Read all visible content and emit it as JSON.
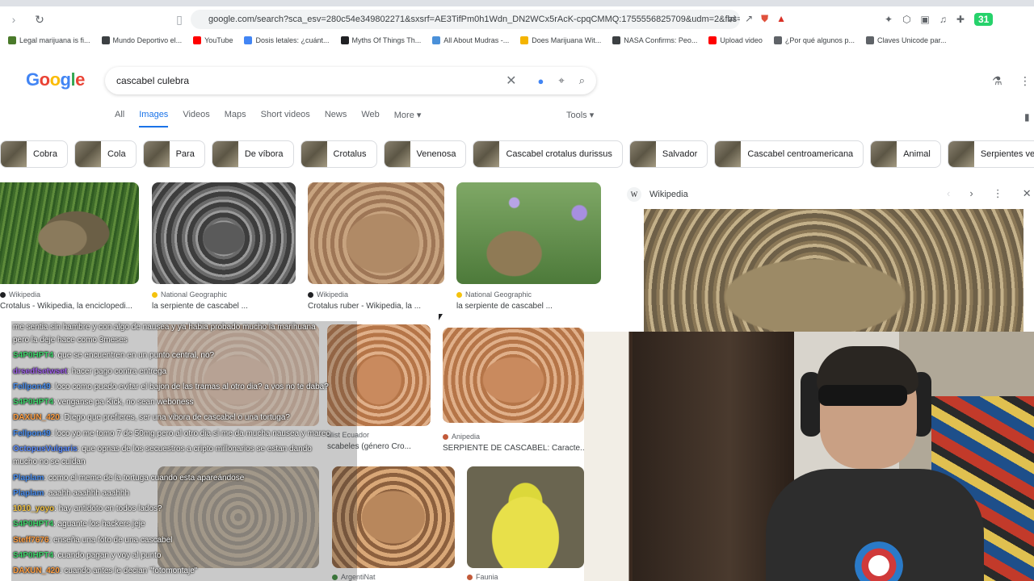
{
  "browser": {
    "url": "google.com/search?sca_esv=280c54e349802271&sxsrf=AE3TifPm0h1Wdn_DN2WCx5rAcK-cpqCMMQ:1755556825709&udm=2&fbs=AIjpHxU...",
    "extension_badge": "31",
    "bookmarks": [
      {
        "label": "Legal marijuana is fi...",
        "color": "#4a7a2a"
      },
      {
        "label": "Mundo Deportivo el...",
        "color": "#3c4043"
      },
      {
        "label": "YouTube",
        "color": "#ff0000"
      },
      {
        "label": "Dosis letales: ¿cuánt...",
        "color": "#4285f4"
      },
      {
        "label": "Myths Of Things Th...",
        "color": "#202124"
      },
      {
        "label": "All About Mudras -...",
        "color": "#4a90d9"
      },
      {
        "label": "Does Marijuana Wit...",
        "color": "#f4b400"
      },
      {
        "label": "NASA Confirms: Peo...",
        "color": "#3c4043"
      },
      {
        "label": "Upload video",
        "color": "#ff0000"
      },
      {
        "label": "¿Por qué algunos p...",
        "color": "#5f6368"
      },
      {
        "label": "Claves Unicode par...",
        "color": "#5f6368"
      }
    ]
  },
  "search": {
    "logo": [
      "G",
      "o",
      "o",
      "g",
      "l",
      "e"
    ],
    "query": "cascabel culebra"
  },
  "tabs": [
    "All",
    "Images",
    "Videos",
    "Maps",
    "Short videos",
    "News",
    "Web",
    "More"
  ],
  "active_tab": "Images",
  "tools_label": "Tools",
  "chips": [
    "Cobra",
    "Cola",
    "Para",
    "De víbora",
    "Crotalus",
    "Venenosa",
    "Cascabel crotalus durissus",
    "Salvador",
    "Cascabel centroamericana",
    "Animal",
    "Serpientes venenosas"
  ],
  "results": [
    {
      "source": "Wikipedia",
      "caption": "Crotalus - Wikipedia, la enciclopedi..."
    },
    {
      "source": "National Geographic",
      "caption": "la serpiente de cascabel ..."
    },
    {
      "source": "Wikipedia",
      "caption": "Crotalus ruber - Wikipedia, la ..."
    },
    {
      "source": "National Geographic",
      "caption": "la serpiente de cascabel ..."
    },
    {
      "source": "alist Ecuador",
      "caption": "scabeles (género Cro..."
    },
    {
      "source": "Anipedia",
      "caption": "SERPIENTE DE CASCABEL: Caracte..."
    },
    {
      "source": "ArgentiNat",
      "caption": ""
    },
    {
      "source": "Faunia",
      "caption": ""
    }
  ],
  "panel": {
    "source": "Wikipedia"
  },
  "chat": [
    {
      "user": "",
      "color": "#ffffff",
      "text": "me sentia sin hambre y con algo de nausea y ya habia probado mucho la marihuana"
    },
    {
      "user": "",
      "color": "#ffffff",
      "text": "pero la deje hace como 3meses"
    },
    {
      "user": "S4P0HPT4",
      "color": "#3fd36b",
      "text": ": que se encuentren en un punto central, no?"
    },
    {
      "user": "drsedfsetwset",
      "color": "#9b5de5",
      "text": ": hacer pago contra entrega"
    },
    {
      "user": "Fellpon49",
      "color": "#4a8ff0",
      "text": ": loco como puedo evitar el bajon de las tramas al otro dia? a vos no te daba?"
    },
    {
      "user": "S4P0HPT4",
      "color": "#3fd36b",
      "text": ": venganse pa Kick, no sean weboness"
    },
    {
      "user": "DAXUN_420",
      "color": "#ff9f43",
      "text": ": Diego que prefieres, ser una vibora de cascabel o una tortuga?"
    },
    {
      "user": "Fellpon49",
      "color": "#4a8ff0",
      "text": ": loco yo me tomo 7 de 50mg pero al otro dia si me da mucha nausea y mareo"
    },
    {
      "user": "OctopusVulgaris",
      "color": "#5b8cff",
      "text": ": que opnas de los secuestros a cripto millonarios se estan dando"
    },
    {
      "user": "",
      "color": "#ffffff",
      "text": "mucho no se cuidan"
    },
    {
      "user": "Plaplam",
      "color": "#4a8ff0",
      "text": ": como el meme de la tortuga cuando esta apareándose"
    },
    {
      "user": "Plaplam",
      "color": "#4a8ff0",
      "text": ": aaahh aaahhh aaahhh"
    },
    {
      "user": "1010_yoyo",
      "color": "#f5c542",
      "text": ": hay antidoto en todos lados?"
    },
    {
      "user": "S4P0HPT4",
      "color": "#3fd36b",
      "text": ": aguante los hackers jeje"
    },
    {
      "user": "Steff7676",
      "color": "#ff9f43",
      "text": ": enseña una foto de una cascabel"
    },
    {
      "user": "S4P0HPT4",
      "color": "#3fd36b",
      "text": ": cuando pagan y voy al punto"
    },
    {
      "user": "DAXUN_420",
      "color": "#ff9f43",
      "text": ": cuando antes le decian \"fotomontaje\""
    }
  ]
}
